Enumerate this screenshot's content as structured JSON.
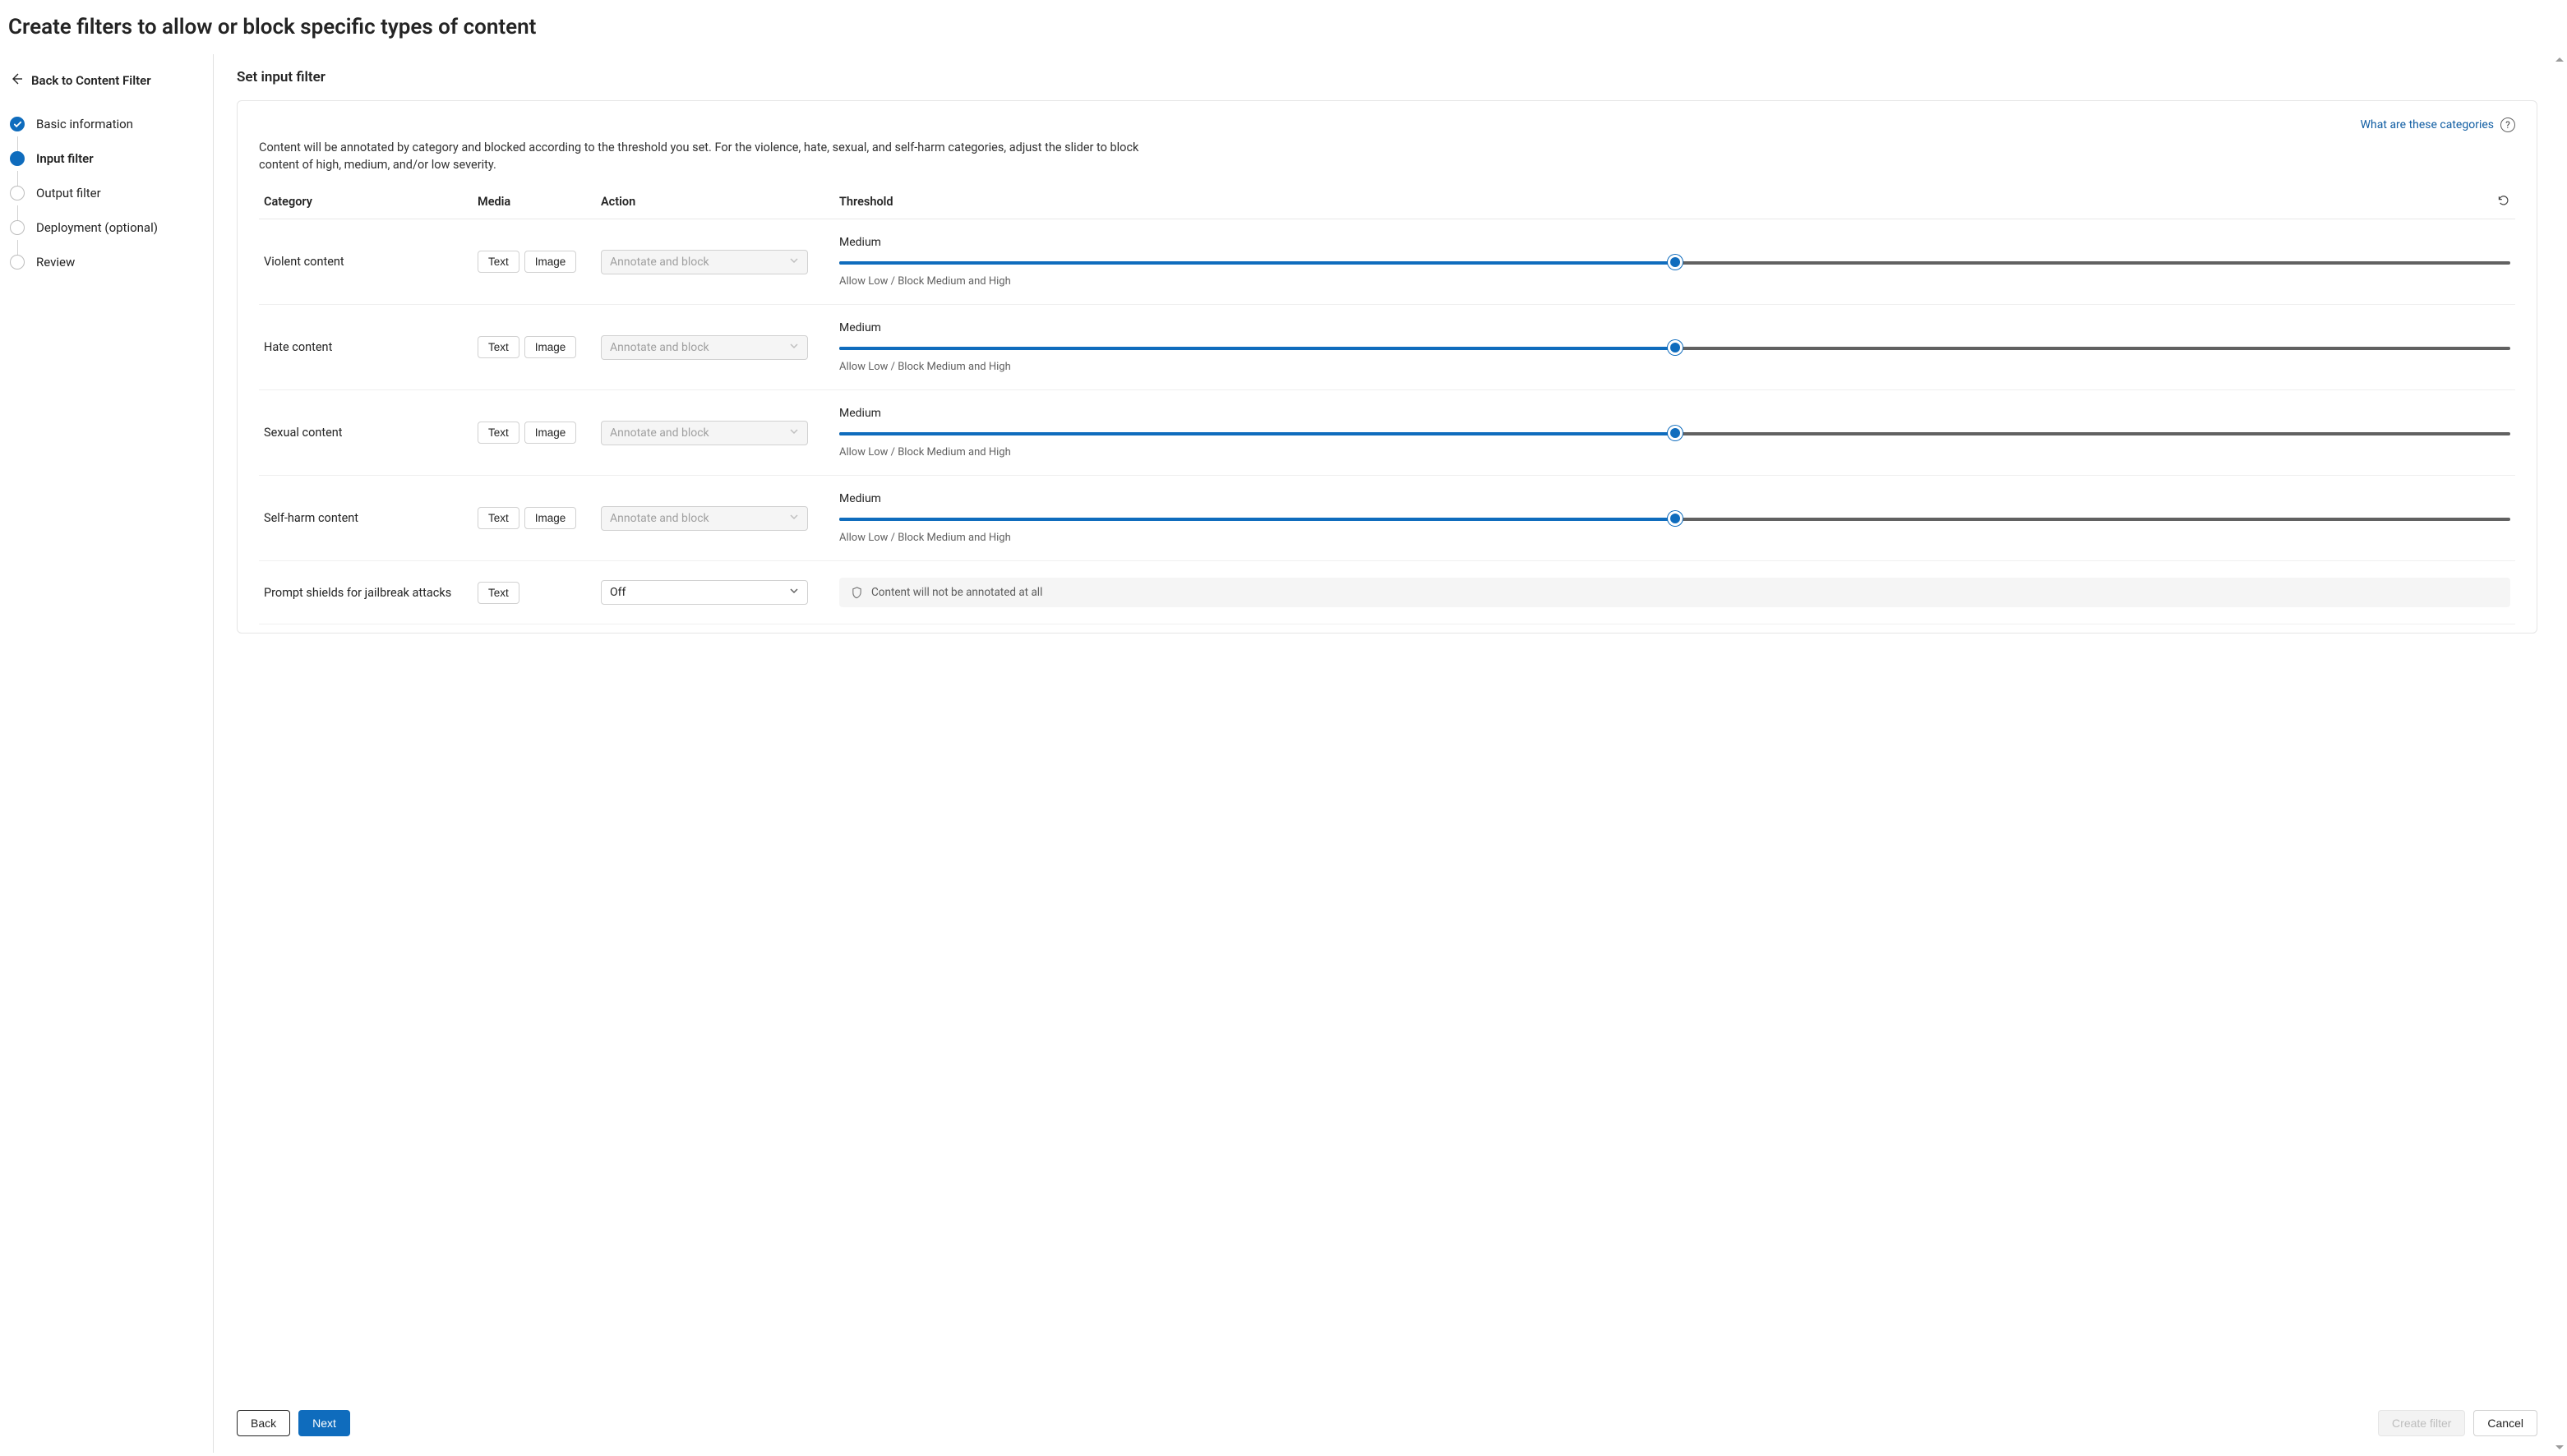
{
  "page": {
    "title": "Create filters to allow or block specific types of content"
  },
  "sidebar": {
    "back_label": "Back to Content Filter",
    "steps": [
      {
        "label": "Basic information",
        "state": "done"
      },
      {
        "label": "Input filter",
        "state": "current"
      },
      {
        "label": "Output filter",
        "state": "pending"
      },
      {
        "label": "Deployment (optional)",
        "state": "pending"
      },
      {
        "label": "Review",
        "state": "pending"
      }
    ]
  },
  "main": {
    "section_title": "Set input filter",
    "help_link": "What are these categories",
    "intro": "Content will be annotated by category and blocked according to the threshold you set. For the violence, hate, sexual, and self-harm categories, adjust the slider to block content of high, medium, and/or low severity.",
    "columns": {
      "category": "Category",
      "media": "Media",
      "action": "Action",
      "threshold": "Threshold"
    },
    "media_labels": {
      "text": "Text",
      "image": "Image"
    },
    "rows": [
      {
        "name": "Violent content",
        "media": [
          "text",
          "image"
        ],
        "action_value": "Annotate and block",
        "action_disabled": true,
        "threshold": {
          "label": "Medium",
          "pct": 50,
          "caption": "Allow Low / Block Medium and High"
        }
      },
      {
        "name": "Hate content",
        "media": [
          "text",
          "image"
        ],
        "action_value": "Annotate and block",
        "action_disabled": true,
        "threshold": {
          "label": "Medium",
          "pct": 50,
          "caption": "Allow Low / Block Medium and High"
        }
      },
      {
        "name": "Sexual content",
        "media": [
          "text",
          "image"
        ],
        "action_value": "Annotate and block",
        "action_disabled": true,
        "threshold": {
          "label": "Medium",
          "pct": 50,
          "caption": "Allow Low / Block Medium and High"
        }
      },
      {
        "name": "Self-harm content",
        "media": [
          "text",
          "image"
        ],
        "action_value": "Annotate and block",
        "action_disabled": true,
        "threshold": {
          "label": "Medium",
          "pct": 50,
          "caption": "Allow Low / Block Medium and High"
        }
      },
      {
        "name": "Prompt shields for jailbreak attacks",
        "media": [
          "text"
        ],
        "action_value": "Off",
        "action_disabled": false,
        "info": "Content will not be annotated at all"
      }
    ]
  },
  "footer": {
    "back": "Back",
    "next": "Next",
    "create": "Create filter",
    "cancel": "Cancel"
  }
}
